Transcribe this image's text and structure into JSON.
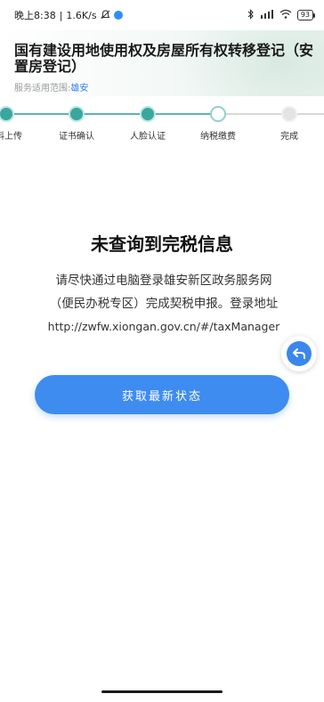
{
  "status_bar": {
    "time": "晚上8:38",
    "speed": "1.6K/s",
    "battery": "93"
  },
  "header": {
    "title": "国有建设用地使用权及房屋所有权转移登记（安置房登记）",
    "scope_label": "服务适用范围:",
    "scope_value": "雄安"
  },
  "steps": [
    {
      "label": "料上传",
      "state": "done"
    },
    {
      "label": "证书确认",
      "state": "done"
    },
    {
      "label": "人脸认证",
      "state": "done"
    },
    {
      "label": "纳税缴费",
      "state": "current"
    },
    {
      "label": "完成",
      "state": "todo"
    }
  ],
  "message": {
    "title": "未查询到完税信息",
    "line1": "请尽快通过电脑登录雄安新区政务服务网",
    "line2": "（便民办税专区）完成契税申报。登录地址",
    "link": "http://zwfw.xiongan.gov.cn/#/taxManager"
  },
  "actions": {
    "refresh_label": "获取最新状态"
  },
  "colors": {
    "accent": "#3e8cf0",
    "step_done": "#3aa79f",
    "scope_value": "#2f7ff0"
  }
}
